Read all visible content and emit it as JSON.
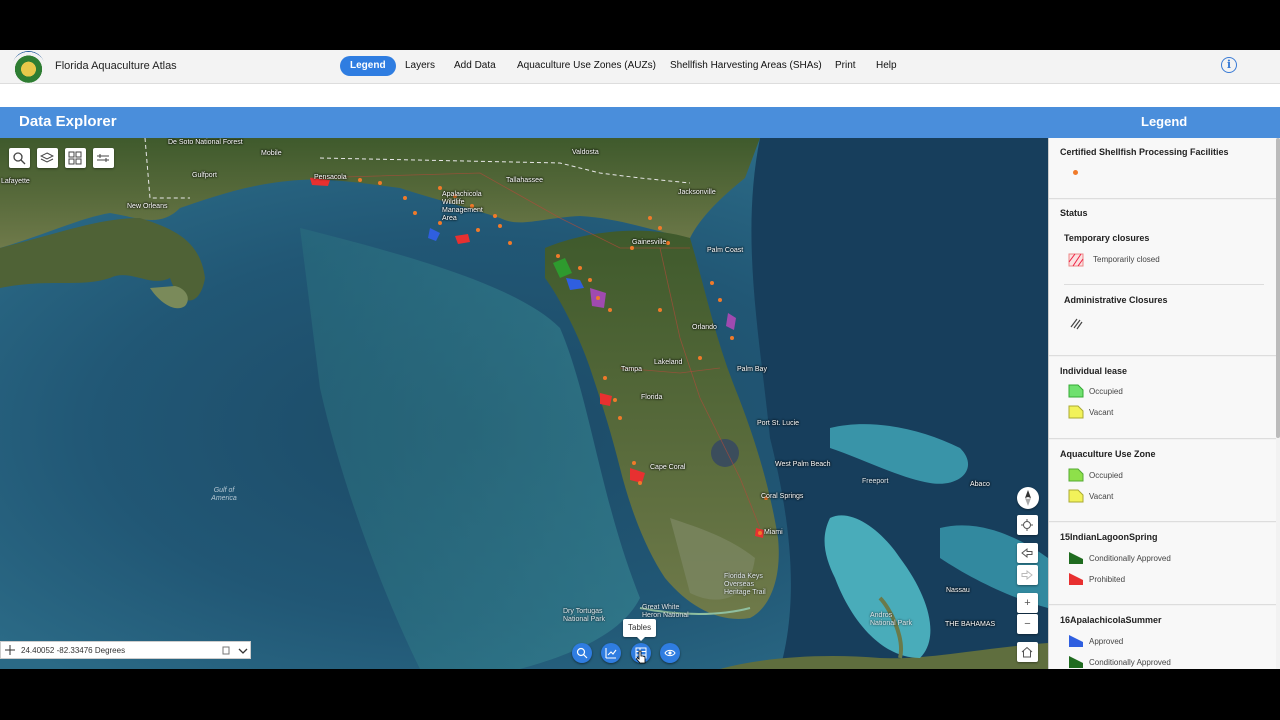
{
  "app": {
    "title": "Florida Aquaculture Atlas",
    "logo_icon": "florida-seal-icon"
  },
  "nav": {
    "items": [
      {
        "label": "Legend",
        "active": true
      },
      {
        "label": "Layers",
        "active": false
      },
      {
        "label": "Add Data",
        "active": false
      },
      {
        "label": "Aquaculture Use Zones (AUZs)",
        "active": false
      },
      {
        "label": "Shellfish Harvesting Areas (SHAs)",
        "active": false
      },
      {
        "label": "Print",
        "active": false
      },
      {
        "label": "Help",
        "active": false
      }
    ],
    "info_icon": "info-icon",
    "info_glyph": "i"
  },
  "header": {
    "explorer_title": "Data Explorer",
    "legend_title": "Legend"
  },
  "map": {
    "labels": {
      "de_soto": "De Soto National Forest",
      "mobile": "Mobile",
      "gulfport": "Gulfport",
      "new_orleans": "New Orleans",
      "lafayette": "Lafayette",
      "pensacola": "Pensacola",
      "tallahassee": "Tallahassee",
      "valdosta": "Valdosta",
      "apalachicola": "Apalachicola Wildlife Management Area",
      "jacksonville": "Jacksonville",
      "gainesville": "Gainesville",
      "palm_coast": "Palm Coast",
      "orlando": "Orlando",
      "tampa": "Tampa",
      "lakeland": "Lakeland",
      "florida": "Florida",
      "palm_bay": "Palm Bay",
      "port_st_lucie": "Port St. Lucie",
      "west_palm_beach": "West Palm Beach",
      "cape_coral": "Cape Coral",
      "coral_springs": "Coral Springs",
      "miami": "Miami",
      "freeport": "Freeport",
      "abaco": "Abaco",
      "nassau": "Nassau",
      "the_bahamas": "THE BAHAMAS",
      "andros": "Andros National Park",
      "gulf_of_america": "Gulf of America",
      "dry_tortugas": "Dry Tortugas National Park",
      "great_white_heron": "Great White Heron National",
      "florida_keys": "Florida Keys Overseas Heritage Trail"
    },
    "tools": [
      "search-icon",
      "layers-icon",
      "qr-grid-icon",
      "measure-icon"
    ],
    "right_controls": {
      "compass": "compass-icon",
      "locate": "locate-icon",
      "back": "arrow-left-icon",
      "forward": "arrow-right-icon",
      "zoom_in": "+",
      "zoom_out": "−",
      "home": "home-icon"
    },
    "coordinates": "24.40052 -82.33476 Degrees",
    "bottom_tools": [
      "search-icon",
      "chart-icon",
      "table-icon",
      "eye-icon"
    ],
    "tooltip": "Tables"
  },
  "legend": {
    "certified": {
      "title": "Certified Shellfish Processing Facilities",
      "color": "#f07a2a"
    },
    "status": {
      "title": "Status",
      "temporary": {
        "title": "Temporary closures",
        "label": "Temporarily closed"
      },
      "administrative": {
        "title": "Administrative Closures"
      }
    },
    "individual_lease": {
      "title": "Individual lease",
      "items": [
        {
          "label": "Occupied",
          "color": "#6fe06f"
        },
        {
          "label": "Vacant",
          "color": "#f2f25a"
        }
      ]
    },
    "auz": {
      "title": "Aquaculture Use Zone",
      "items": [
        {
          "label": "Occupied",
          "color": "#8ee04a"
        },
        {
          "label": "Vacant",
          "color": "#f2f25a"
        }
      ]
    },
    "indian_lagoon": {
      "title": "15IndianLagoonSpring",
      "items": [
        {
          "label": "Conditionally Approved",
          "color": "#1f6b1f"
        },
        {
          "label": "Prohibited",
          "color": "#e83030"
        }
      ]
    },
    "apalachicola": {
      "title": "16ApalachicolaSummer",
      "items": [
        {
          "label": "Approved",
          "color": "#2f5fe0"
        },
        {
          "label": "Conditionally Approved",
          "color": "#1f6b1f"
        }
      ]
    }
  }
}
